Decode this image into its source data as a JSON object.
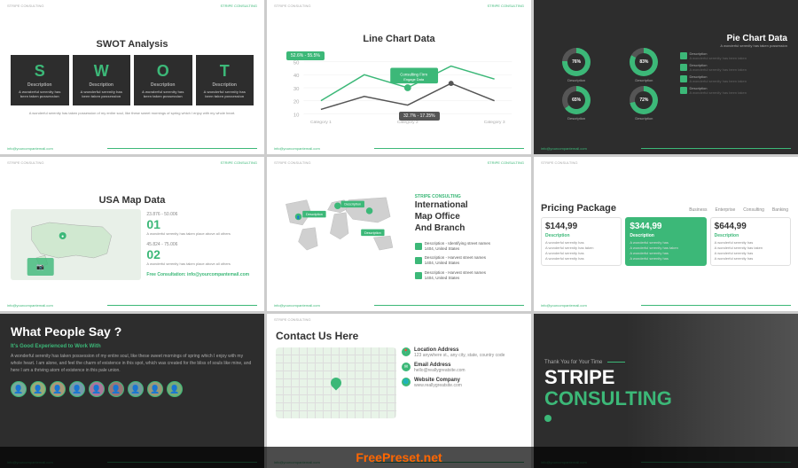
{
  "slides": [
    {
      "id": "swot",
      "title": "SWOT Analysis",
      "letters": [
        "S",
        "W",
        "O",
        "T"
      ],
      "labels": [
        "Description",
        "Description",
        "Description",
        "Description"
      ],
      "desc": "A wonderful serenity has taken possession of my entire soul, like these sweet mornings of spring which I enjoy with my whole heart.",
      "footer_email": "info@yourcompantemail.com"
    },
    {
      "id": "line-chart",
      "title": "Line Chart Data",
      "badge1": "52.6% - 55.5%",
      "badge2": "32.7% - 17.25%",
      "categories": [
        "Category 1",
        "Category 2",
        "Category 3"
      ],
      "footer_email": "info@yourcompantemail.com"
    },
    {
      "id": "pie-chart",
      "title": "Pie Chart Data",
      "subtitle": "A wonderful serenity has taken possession",
      "values": [
        76,
        83,
        65,
        72
      ],
      "labels": [
        "Description",
        "Description",
        "Description",
        "Description"
      ],
      "desc_items": [
        "Description",
        "Description",
        "Description",
        "Description"
      ],
      "footer_email": "info@yourcompantemail.com"
    },
    {
      "id": "usa-map",
      "title": "USA Map Data",
      "stat1_range": "23.876 - 50.006",
      "stat1_num": "01",
      "stat1_desc": "A wonderful serenity has taken place above all others",
      "stat2_range": "45.824 - 75.006",
      "stat2_num": "02",
      "stat2_desc": "A wonderful serenity has taken place above all others",
      "consult": "Free Consultation:",
      "consult_email": "info@yourcompantemail.com",
      "footer_email": "info@yourcompantemail.com"
    },
    {
      "id": "intl-map",
      "title": "International\nMap Office\nAnd Branch",
      "top_label": "STRIPE CONSULTING",
      "descriptions": [
        "Description",
        "Description",
        "Description"
      ],
      "footer_email": "info@yourcompantemail.com"
    },
    {
      "id": "pricing",
      "title": "Pricing Package",
      "tabs": [
        "Business",
        "Enterprise",
        "Consulting",
        "Banking"
      ],
      "cards": [
        {
          "price": "$144,99",
          "plan": "Description",
          "features": [
            "A wonderful serenity has",
            "A wonderful serenity has taken",
            "A wonderful serenity has",
            "A wonderful serenity has"
          ]
        },
        {
          "price": "$344,99",
          "plan": "Description",
          "features": [
            "A wonderful serenity has",
            "A wonderful serenity has taken",
            "A wonderful serenity has",
            "A wonderful serenity has"
          ],
          "featured": true
        },
        {
          "price": "$644,99",
          "plan": "Description",
          "features": [
            "A wonderful serenity has",
            "A wonderful serenity has taken",
            "A wonderful serenity has",
            "A wonderful serenity has"
          ]
        }
      ],
      "footer_email": "info@yourcompantemail.com"
    },
    {
      "id": "testimonial",
      "title": "What People Say ?",
      "subtitle": "It's Good Experienced to Work With",
      "text": "A wonderful serenity has taken possession of my entire soul, like these sweet mornings of spring which I enjoy with my whole heart. I am alone, and feel the charm of existence in this spot, which was created for the bliss of souls like mine, and here I am a thriving atom of existence in this pale union.",
      "avatar_count": 9,
      "footer_email": "info@yourcompantemail.com"
    },
    {
      "id": "contact",
      "title": "Contact Us Here",
      "address_label": "Location Address",
      "address_value": "123 anywhere st., any city, state, country code",
      "email_label": "Email Address",
      "email_value": "hello@reallygreatsite.com",
      "website_label": "Website Company",
      "website_value": "www.reallygreatsite.com",
      "footer_email": "info@yourcompantemail.com"
    },
    {
      "id": "stripe",
      "thank": "Thank You for Your Time",
      "line1": "STRIPE",
      "line2": "CONSULTING",
      "footer_email": "info@yourcompantemail.com"
    }
  ],
  "watermark": {
    "prefix": "Free",
    "highlight": "Preset",
    "suffix": ".net"
  },
  "brand": {
    "green": "#3cb878",
    "dark": "#2d2d2d"
  }
}
